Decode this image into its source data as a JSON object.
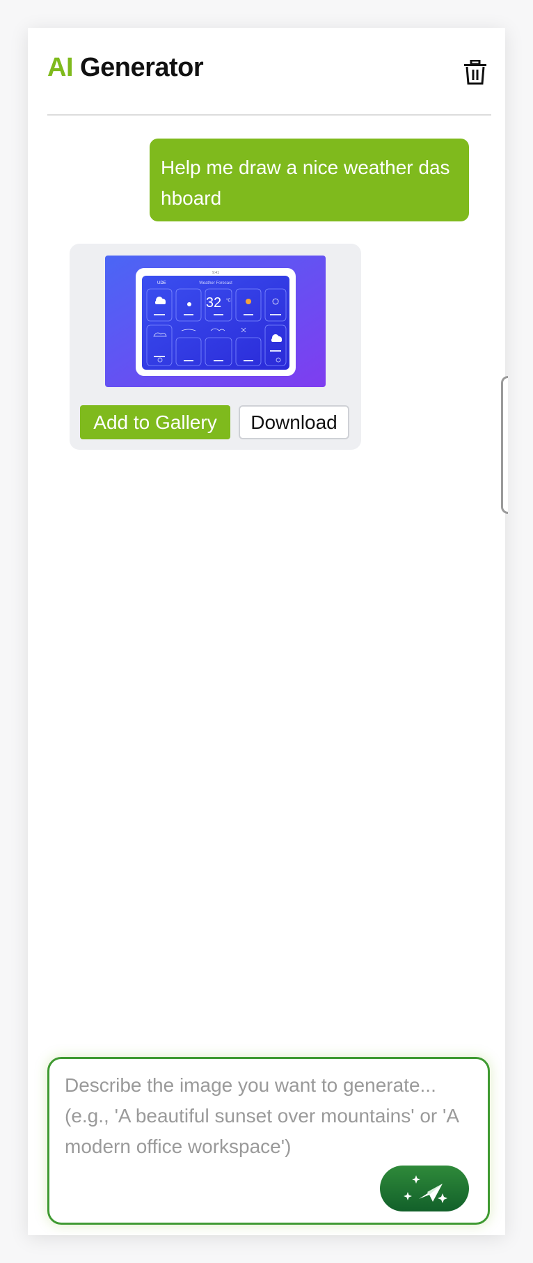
{
  "header": {
    "title_accent": "AI",
    "title_main": " Generator",
    "delete_icon": "trash-icon"
  },
  "chat": {
    "user_message": "Help me draw a nice weather dashboard",
    "result": {
      "thumbnail": {
        "time": "9:41",
        "location": "UDE",
        "headline": "Weather Forecast",
        "temperature": "32",
        "unit": "°C"
      },
      "add_to_gallery_label": "Add to Gallery",
      "download_label": "Download"
    }
  },
  "composer": {
    "placeholder": "Describe the image you want to generate... (e.g., 'A beautiful sunset over mountains' or 'A modern office workspace')",
    "send_icon": "sparkle-send-icon"
  },
  "colors": {
    "accent": "#7fba1d",
    "send_button": "#1e7a33"
  }
}
